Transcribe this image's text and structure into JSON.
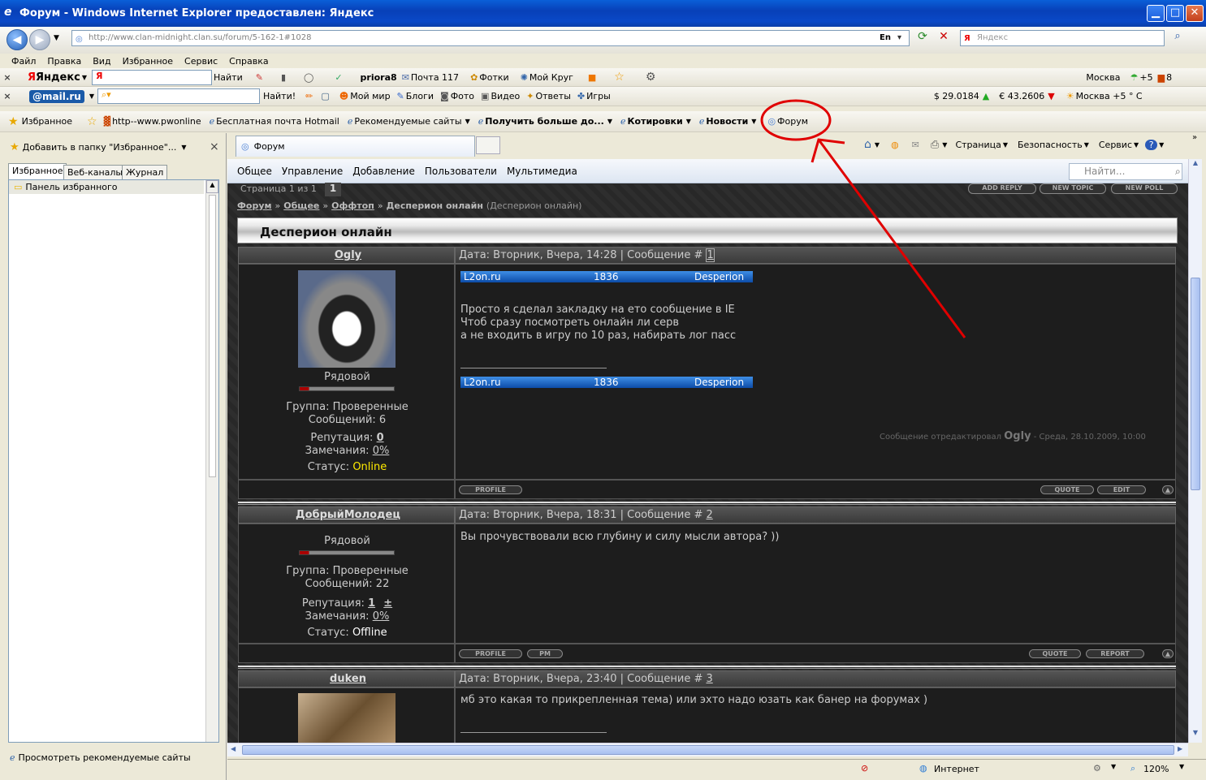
{
  "window": {
    "title": "Форум - Windows Internet Explorer предоставлен: Яндекс",
    "minimize": "▁",
    "maximize": "□",
    "close": "✕"
  },
  "address": {
    "url": "http://www.clan-midnight.clan.su/forum/5-162-1#1028",
    "lang": "En",
    "search_placeholder": "Яндекс"
  },
  "menu": [
    "Файл",
    "Правка",
    "Вид",
    "Избранное",
    "Сервис",
    "Справка"
  ],
  "yandex_bar": {
    "logo": "Яндекс",
    "find": "Найти",
    "user": "priora8",
    "mail": "Почта 117",
    "photos": "Фотки",
    "circle": "Мой Круг",
    "city": "Москва",
    "temp": "+5",
    "count": "8"
  },
  "mailru_bar": {
    "logo": "@mail.ru",
    "find": "Найти!",
    "world": "Мой мир",
    "blogs": "Блоги",
    "photo": "Фото",
    "video": "Видео",
    "answers": "Ответы",
    "games": "Игры",
    "usd": "$ 29.0184",
    "eur": "€ 43.2606",
    "weather": "Москва +5 ° C"
  },
  "favbar": {
    "favorites": "Избранное",
    "items": [
      "http--www.pwonline",
      "Бесплатная почта Hotmail",
      "Рекомендуемые сайты",
      "Получить больше до...",
      "Котировки",
      "Новости",
      "Форум"
    ]
  },
  "leftpane": {
    "add": "Добавить в папку \"Избранное\"...",
    "tabs": [
      "Избранное",
      "Веб-каналы",
      "Журнал"
    ],
    "folder": "Панель избранного",
    "bottom": "Просмотреть рекомендуемые сайты"
  },
  "tab": {
    "label": "Форум"
  },
  "cmdbar": {
    "page": "Страница",
    "security": "Безопасность",
    "service": "Сервис"
  },
  "forum": {
    "nav": [
      "Общее",
      "Управление",
      "Добавление",
      "Пользователи",
      "Мультимедиа"
    ],
    "search_placeholder": "Найти...",
    "pages": "Страница 1 из 1",
    "page_num": "1",
    "buttons": [
      "ADD REPLY",
      "NEW TOPIC",
      "NEW POLL"
    ],
    "breadcrumb": {
      "forum": "Форум",
      "general": "Общее",
      "offtop": "Оффтоп",
      "current": "Десперион онлайн",
      "sub": "(Десперион онлайн)",
      "sep": "»"
    },
    "title": "Десперион онлайн",
    "posts": [
      {
        "user": "Ogly",
        "date": "Дата: Вторник, Вчера, 14:28 | Сообщение #",
        "num": "1",
        "rank": "Рядовой",
        "group": "Группа: Проверенные",
        "messages": "Сообщений: 6",
        "rep_label": "Репутация:",
        "rep": "0",
        "warn_label": "Замечания:",
        "warn": "0%",
        "status_label": "Статус:",
        "status": "Online",
        "banner": {
          "site": "L2on.ru",
          "num": "1836",
          "server": "Desperion"
        },
        "text": [
          "Просто я сделал закладку на ето сообщение в IE",
          "Чтоб сразу посмотреть онлайн ли серв",
          "а не входить в игру по 10 раз, набирать лог пасс"
        ],
        "edited_prefix": "Сообщение отредактировал",
        "edited_by": "Ogly",
        "edited_date": "- Среда, 28.10.2009, 10:00",
        "left_btns": [
          "PROFILE"
        ],
        "right_btns": [
          "QUOTE",
          "EDIT"
        ]
      },
      {
        "user": "ДобрыйМолодец",
        "date": "Дата: Вторник, Вчера, 18:31 | Сообщение #",
        "num": "2",
        "rank": "Рядовой",
        "group": "Группа: Проверенные",
        "messages": "Сообщений: 22",
        "rep_label": "Репутация:",
        "rep": "1",
        "rep_pm": "±",
        "warn_label": "Замечания:",
        "warn": "0%",
        "status_label": "Статус:",
        "status": "Offline",
        "text": [
          "Вы прочувствовали всю глубину и силу мысли автора? ))"
        ],
        "left_btns": [
          "PROFILE",
          "PM"
        ],
        "right_btns": [
          "QUOTE",
          "REPORT"
        ]
      },
      {
        "user": "duken",
        "date": "Дата: Вторник, Вчера, 23:40 | Сообщение #",
        "num": "3",
        "text": [
          "мб это какая то прикрепленная тема) или эхто надо юзать как банер на форумах )"
        ]
      }
    ]
  },
  "status": {
    "zone": "Интернет",
    "zoom": "120%"
  },
  "colors": {
    "online": "#ffeb00",
    "annotation": "#e00000"
  }
}
